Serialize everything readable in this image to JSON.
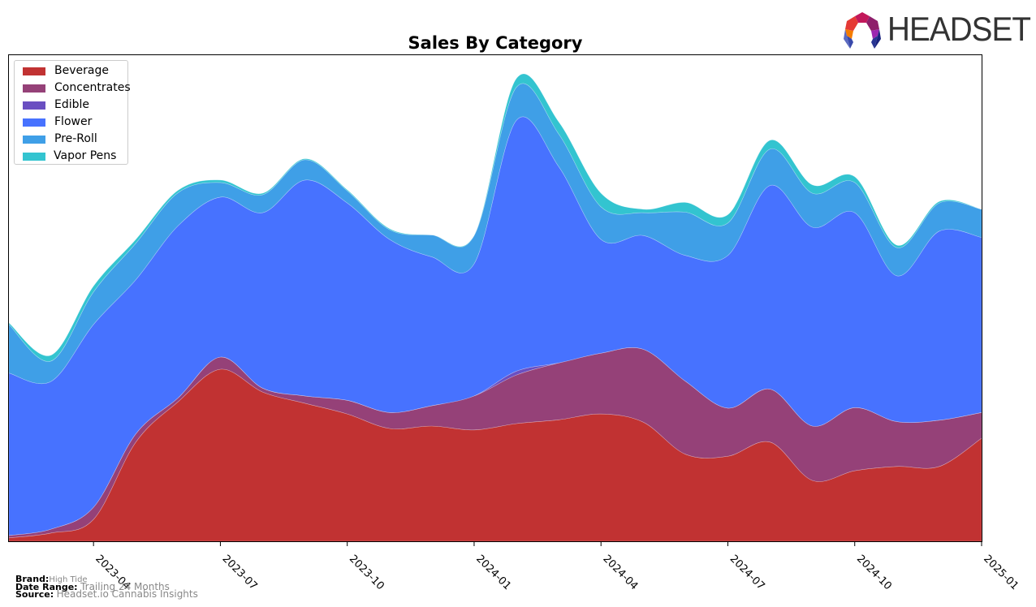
{
  "chart_data": {
    "type": "area",
    "stacked": true,
    "title": "Sales By Category",
    "xlabel": "",
    "ylabel": "",
    "ylim": [
      0,
      100
    ],
    "y_units": "relative sales (unlabeled axis, 0-100 scale of plot height)",
    "grid": false,
    "legend_position": "top-left",
    "x": [
      "2023-02",
      "2023-03",
      "2023-04",
      "2023-05",
      "2023-06",
      "2023-07",
      "2023-08",
      "2023-09",
      "2023-10",
      "2023-11",
      "2023-12",
      "2024-01",
      "2024-02",
      "2024-03",
      "2024-04",
      "2024-05",
      "2024-06",
      "2024-07",
      "2024-08",
      "2024-09",
      "2024-10",
      "2024-11",
      "2024-12",
      "2025-01"
    ],
    "x_ticks": [
      "2023-04",
      "2023-07",
      "2023-10",
      "2024-01",
      "2024-04",
      "2024-07",
      "2024-10",
      "2025-01"
    ],
    "series": [
      {
        "name": "Beverage",
        "color": "#c13232",
        "values": [
          0.7,
          1.7,
          4.5,
          20.4,
          28.7,
          35.4,
          30.7,
          28.4,
          26.2,
          23.2,
          23.7,
          22.9,
          24.2,
          25.0,
          26.2,
          24.5,
          17.9,
          17.5,
          20.4,
          12.5,
          14.5,
          15.4,
          15.4,
          21.2
        ]
      },
      {
        "name": "Concentrates",
        "color": "#954178",
        "values": [
          0.5,
          0.8,
          2.5,
          1.7,
          0.8,
          2.5,
          0.8,
          1.5,
          2.8,
          3.3,
          4.2,
          7.0,
          10.0,
          11.7,
          12.5,
          15.0,
          15.0,
          9.9,
          10.9,
          11.2,
          13.0,
          9.2,
          9.5,
          5.3
        ]
      },
      {
        "name": "Edible",
        "color": "#6a4fc1",
        "values": [
          0,
          0,
          0,
          0,
          0,
          0,
          0,
          0,
          0,
          0,
          0,
          0,
          0.8,
          0,
          0,
          0,
          0,
          0,
          0,
          0,
          0,
          0,
          0,
          0
        ]
      },
      {
        "name": "Flower",
        "color": "#4772ff",
        "values": [
          33.4,
          30.4,
          37.6,
          31.7,
          35.4,
          32.9,
          36.1,
          44.4,
          40.6,
          35.6,
          30.6,
          27.2,
          51.6,
          40.4,
          23.4,
          23.4,
          25.9,
          31.4,
          41.9,
          40.9,
          40.1,
          30.0,
          38.9,
          36.0
        ]
      },
      {
        "name": "Pre-Roll",
        "color": "#3f9fe7",
        "values": [
          10.0,
          4.2,
          6.7,
          7.5,
          6.8,
          3.0,
          3.7,
          4.2,
          2.5,
          2.0,
          4.5,
          5.8,
          6.8,
          6.7,
          6.7,
          4.7,
          8.9,
          6.7,
          7.5,
          7.0,
          6.2,
          5.8,
          5.8,
          5.8
        ]
      },
      {
        "name": "Vapor Pens",
        "color": "#33c4d0",
        "values": [
          0.3,
          1.2,
          1.2,
          0.8,
          0.5,
          0.5,
          0.3,
          0.2,
          0.2,
          0.2,
          0,
          0,
          1.8,
          2.5,
          2.8,
          0.7,
          2.0,
          1.7,
          1.8,
          1.7,
          1.2,
          0.5,
          0.3,
          0
        ]
      }
    ]
  },
  "legend": {
    "items": [
      {
        "label": "Beverage",
        "color": "#c13232"
      },
      {
        "label": "Concentrates",
        "color": "#954178"
      },
      {
        "label": "Edible",
        "color": "#6a4fc1"
      },
      {
        "label": "Flower",
        "color": "#4772ff"
      },
      {
        "label": "Pre-Roll",
        "color": "#3f9fe7"
      },
      {
        "label": "Vapor Pens",
        "color": "#33c4d0"
      }
    ]
  },
  "footer": {
    "brand_label": "Brand:",
    "brand_value": "High Tide",
    "date_range_label": "Date Range:",
    "date_range_value": "Trailing 24 Months",
    "source_label": "Source:",
    "source_value": "Headset.io Cannabis Insights"
  },
  "logo": {
    "text": "HEADSET"
  }
}
